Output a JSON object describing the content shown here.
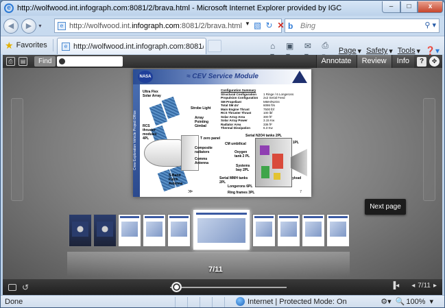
{
  "window": {
    "title": "http://wolfwood.int.infograph.com:8081/2/brava.html - Microsoft Internet Explorer provided by IGC",
    "controls": {
      "minimize": "–",
      "maximize": "□",
      "close": "x"
    }
  },
  "address_bar": {
    "url_prefix": "http://wolfwood.int.",
    "url_host": "infograph.com",
    "url_suffix": ":8081/2/brava.html",
    "search_placeholder": "Bing"
  },
  "favorites_bar": {
    "favorites_label": "Favorites",
    "tab_title": "http://wolfwood.int.infograph.com:8081/2/brava...",
    "commands": {
      "page": "Page",
      "safety": "Safety",
      "tools": "Tools"
    }
  },
  "viewer": {
    "find_label": "Find",
    "tabs": [
      "Annotate",
      "Review",
      "Info"
    ],
    "active_tab": "Review",
    "help_label": "?",
    "tooltip": "Next page",
    "page_counter": "7/11",
    "bottom_counter": "7/11",
    "document": {
      "heading": "CEV Service Module",
      "nasa_label": "NASA",
      "side_band": "Crew Exploration Vehicle Project Office",
      "callouts": [
        "Ultra Flex Solar Array",
        "Strobe Light",
        "Array Pointing Gimbal",
        "RCS thruster modules 4PL",
        "T zero panel",
        "Composite radiators",
        "Comms Antenna",
        "S-Band Patch Antenna",
        "Serial N2O4 tanks 2PL",
        "CM umbilical",
        "Oxygen tank 2 PL",
        "Systems bay 2PL",
        "Serial MMH tanks 2PL",
        "Longerons 6PL",
        "Ring frames 3PL",
        "OMS 1PL",
        "Payload"
      ],
      "spec_title": "Configuration Summary",
      "spec_rows": [
        {
          "k": "Structural Configuration",
          "v": "1 Ringe / 6 Longerons"
        },
        {
          "k": "Propulsion Configuration",
          "v": "2x2 Serial Feed"
        },
        {
          "k": "SM Propellant",
          "v": "MMH/N2O4"
        },
        {
          "k": "Total SM ΔV",
          "v": "6086 ft/s"
        },
        {
          "k": "Main Engine Thrust",
          "v": "7500 lbf"
        },
        {
          "k": "RCS Thruster Thrust",
          "v": "100 lbf"
        },
        {
          "k": "Solar Array Area",
          "v": "300 ft²"
        },
        {
          "k": "Solar Array Power",
          "v": "3.15 Kw"
        },
        {
          "k": "Radiator Area",
          "v": "336 ft²"
        },
        {
          "k": "Thermal Dissipation",
          "v": "6.3 Kw"
        }
      ],
      "page_number": "7"
    }
  },
  "status_bar": {
    "left": "Done",
    "zone": "Internet | Protected Mode: On",
    "zoom": "100%"
  },
  "colors": {
    "viewer_bg": "#5a5a5a",
    "toolbar_dark": "#2e2e2e",
    "nasa_blue": "#243f8c"
  }
}
